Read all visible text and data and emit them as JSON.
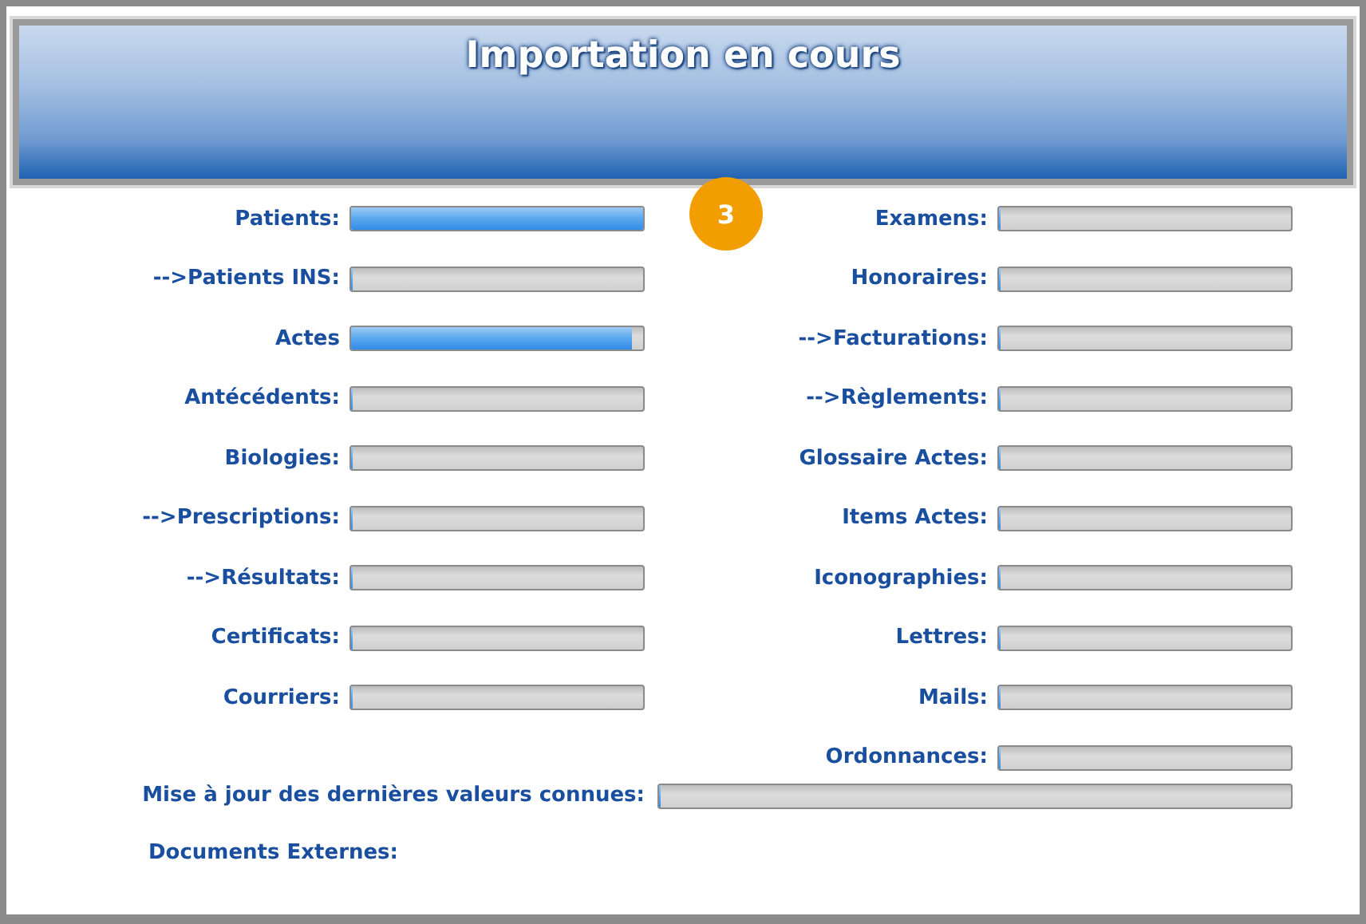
{
  "header": {
    "title": "Importation en cours"
  },
  "badge": {
    "text": "3"
  },
  "left_items": [
    {
      "label": "Patients:",
      "level": 1
    },
    {
      "label": "-->Patients INS:",
      "level": 0
    },
    {
      "label": "Actes",
      "level": 0.96
    },
    {
      "label": "Antécédents:",
      "level": 0
    },
    {
      "label": "Biologies:",
      "level": 0
    },
    {
      "label": "-->Prescriptions:",
      "level": 0
    },
    {
      "label": "-->Résultats:",
      "level": 0
    },
    {
      "label": "Certificats:",
      "level": 0
    },
    {
      "label": "Courriers:",
      "level": 0
    }
  ],
  "right_items": [
    {
      "label": "Examens:",
      "level": 0
    },
    {
      "label": "Honoraires:",
      "level": 0
    },
    {
      "label": "-->Facturations:",
      "level": 0
    },
    {
      "label": "-->Règlements:",
      "level": 0
    },
    {
      "label": "Glossaire Actes:",
      "level": 0
    },
    {
      "label": "Items Actes:",
      "level": 0
    },
    {
      "label": "Iconographies:",
      "level": 0
    },
    {
      "label": "Lettres:",
      "level": 0
    },
    {
      "label": "Mails:",
      "level": 0
    },
    {
      "label": "Ordonnances:",
      "level": 0
    }
  ],
  "update": {
    "label": "Mise à jour des dernières valeurs connues:",
    "level": 0
  },
  "documents": {
    "label": "Documents Externes:"
  }
}
